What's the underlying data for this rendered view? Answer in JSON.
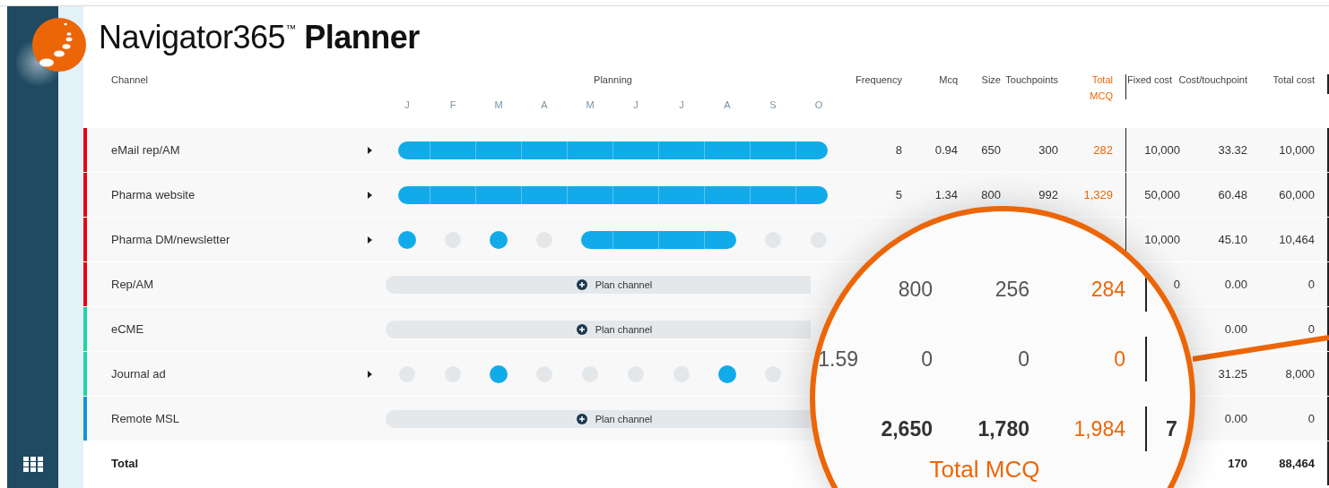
{
  "app": {
    "brand": "Navigator365",
    "trademark": "™",
    "product": "Planner"
  },
  "columns": {
    "channel": "Channel",
    "planning": "Planning",
    "months": [
      "J",
      "F",
      "M",
      "A",
      "M",
      "J",
      "J",
      "A",
      "S",
      "O"
    ],
    "frequency": "Frequency",
    "mcq": "Mcq",
    "size": "Size",
    "touchpoints": "Touchpoints",
    "total_mcq": "Total MCQ",
    "fixed_cost": "Fixed cost",
    "cost_per_touchpoint": "Cost/touchpoint",
    "total_cost": "Total cost"
  },
  "rows": [
    {
      "name": "eMail rep/AM",
      "color": "#e30613",
      "expandable": true,
      "plan": {
        "kind": "timeline",
        "months": [
          {
            "planned": true
          },
          {
            "planned": true
          },
          {
            "planned": true
          },
          {
            "planned": true
          },
          {
            "planned": true
          },
          {
            "planned": true
          },
          {
            "planned": true
          },
          {
            "planned": true
          },
          {
            "planned": true
          },
          {
            "planned": true
          }
        ]
      },
      "frequency": "8",
      "mcq": "0.94",
      "size": "650",
      "touchpoints": "300",
      "total_mcq": "282",
      "fixed_cost": "10,000",
      "cost_per_touchpoint": "33.32",
      "total_cost": "10,000"
    },
    {
      "name": "Pharma website",
      "color": "#e30613",
      "expandable": true,
      "plan": {
        "kind": "timeline",
        "months": [
          {
            "planned": true
          },
          {
            "planned": true
          },
          {
            "planned": true
          },
          {
            "planned": true
          },
          {
            "planned": true
          },
          {
            "planned": true
          },
          {
            "planned": true
          },
          {
            "planned": true
          },
          {
            "planned": true
          },
          {
            "planned": true
          }
        ]
      },
      "frequency": "5",
      "mcq": "1.34",
      "size": "800",
      "touchpoints": "992",
      "total_mcq": "1,329",
      "fixed_cost": "50,000",
      "cost_per_touchpoint": "60.48",
      "total_cost": "60,000"
    },
    {
      "name": "Pharma DM/newsletter",
      "color": "#e30613",
      "expandable": true,
      "plan": {
        "kind": "timeline",
        "months": [
          {
            "planned": true
          },
          {
            "planned": false
          },
          {
            "planned": true
          },
          {
            "planned": false
          },
          {
            "planned": true
          },
          {
            "planned": true
          },
          {
            "planned": true
          },
          {
            "planned": true
          },
          {
            "planned": false
          },
          {
            "planned": false
          }
        ]
      },
      "fixed_cost": "10,000",
      "cost_per_touchpoint": "45.10",
      "total_cost": "10,464"
    },
    {
      "name": "Rep/AM",
      "color": "#e30613",
      "expandable": false,
      "plan": {
        "kind": "empty",
        "button": "Plan channel"
      },
      "fixed_cost": "0",
      "cost_per_touchpoint": "0.00",
      "total_cost": "0"
    },
    {
      "name": "eCME",
      "color": "#1ed6a3",
      "expandable": false,
      "plan": {
        "kind": "empty",
        "button": "Plan channel"
      },
      "cost_per_touchpoint": "0.00",
      "total_cost": "0"
    },
    {
      "name": "Journal ad",
      "color": "#1ed6a3",
      "expandable": true,
      "plan": {
        "kind": "timeline",
        "months": [
          {
            "planned": false
          },
          {
            "planned": false
          },
          {
            "planned": true
          },
          {
            "planned": false
          },
          {
            "planned": false
          },
          {
            "planned": false
          },
          {
            "planned": false
          },
          {
            "planned": true
          },
          {
            "planned": false
          }
        ]
      },
      "cost_per_touchpoint": "31.25",
      "total_cost": "8,000"
    },
    {
      "name": "Remote MSL",
      "color": "#1592d8",
      "expandable": false,
      "plan": {
        "kind": "empty",
        "button": "Plan channel"
      },
      "cost_per_touchpoint": "0.00",
      "total_cost": "0"
    }
  ],
  "total": {
    "label": "Total",
    "cost_per_touchpoint": "170",
    "total_cost": "88,464"
  },
  "magnifier": {
    "rows": [
      {
        "kind": "plain",
        "size": "800",
        "touchpoints": "256",
        "total_mcq": "284"
      },
      {
        "kind": "plain",
        "mcq": "1.59",
        "size": "0",
        "touchpoints": "0",
        "total_mcq": "0"
      },
      {
        "kind": "total",
        "size": "2,650",
        "touchpoints": "1,780",
        "total_mcq": "1,984",
        "fixed_cost": "7"
      }
    ],
    "caption": "Total MCQ"
  }
}
